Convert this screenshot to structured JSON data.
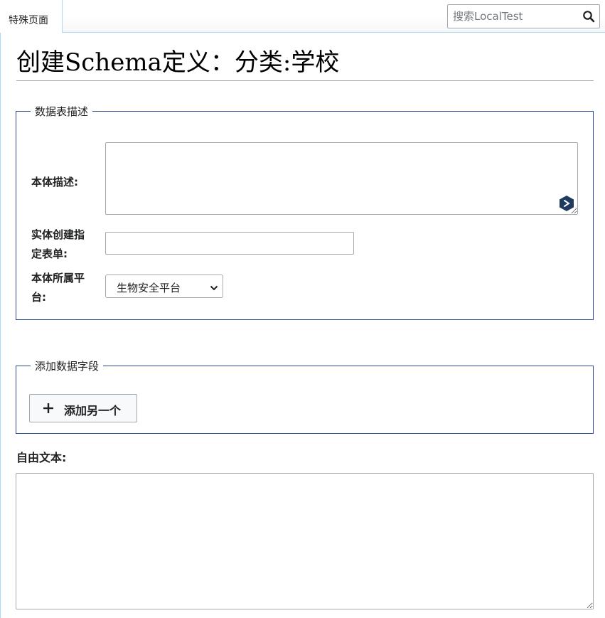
{
  "tabs": [
    {
      "label": "特殊页面"
    }
  ],
  "search": {
    "placeholder": "搜索LocalTest"
  },
  "page": {
    "title": "创建Schema定义：分类:学校"
  },
  "schema_section": {
    "legend": "数据表描述",
    "fields": {
      "description_label": "本体描述:",
      "form_label_line1": "实体创建指",
      "form_label_line2": "定表单:",
      "platform_label_line1": "本体所属平",
      "platform_label_line2": "台:",
      "platform_selected": "生物安全平台"
    }
  },
  "fields_section": {
    "legend": "添加数据字段",
    "add_button_label": "添加另一个"
  },
  "free_text": {
    "label": "自由文本:"
  },
  "colors": {
    "fieldset_border": "#2a4b8d",
    "rail": "#a7d7f9",
    "badge": "#1e3a5f"
  }
}
